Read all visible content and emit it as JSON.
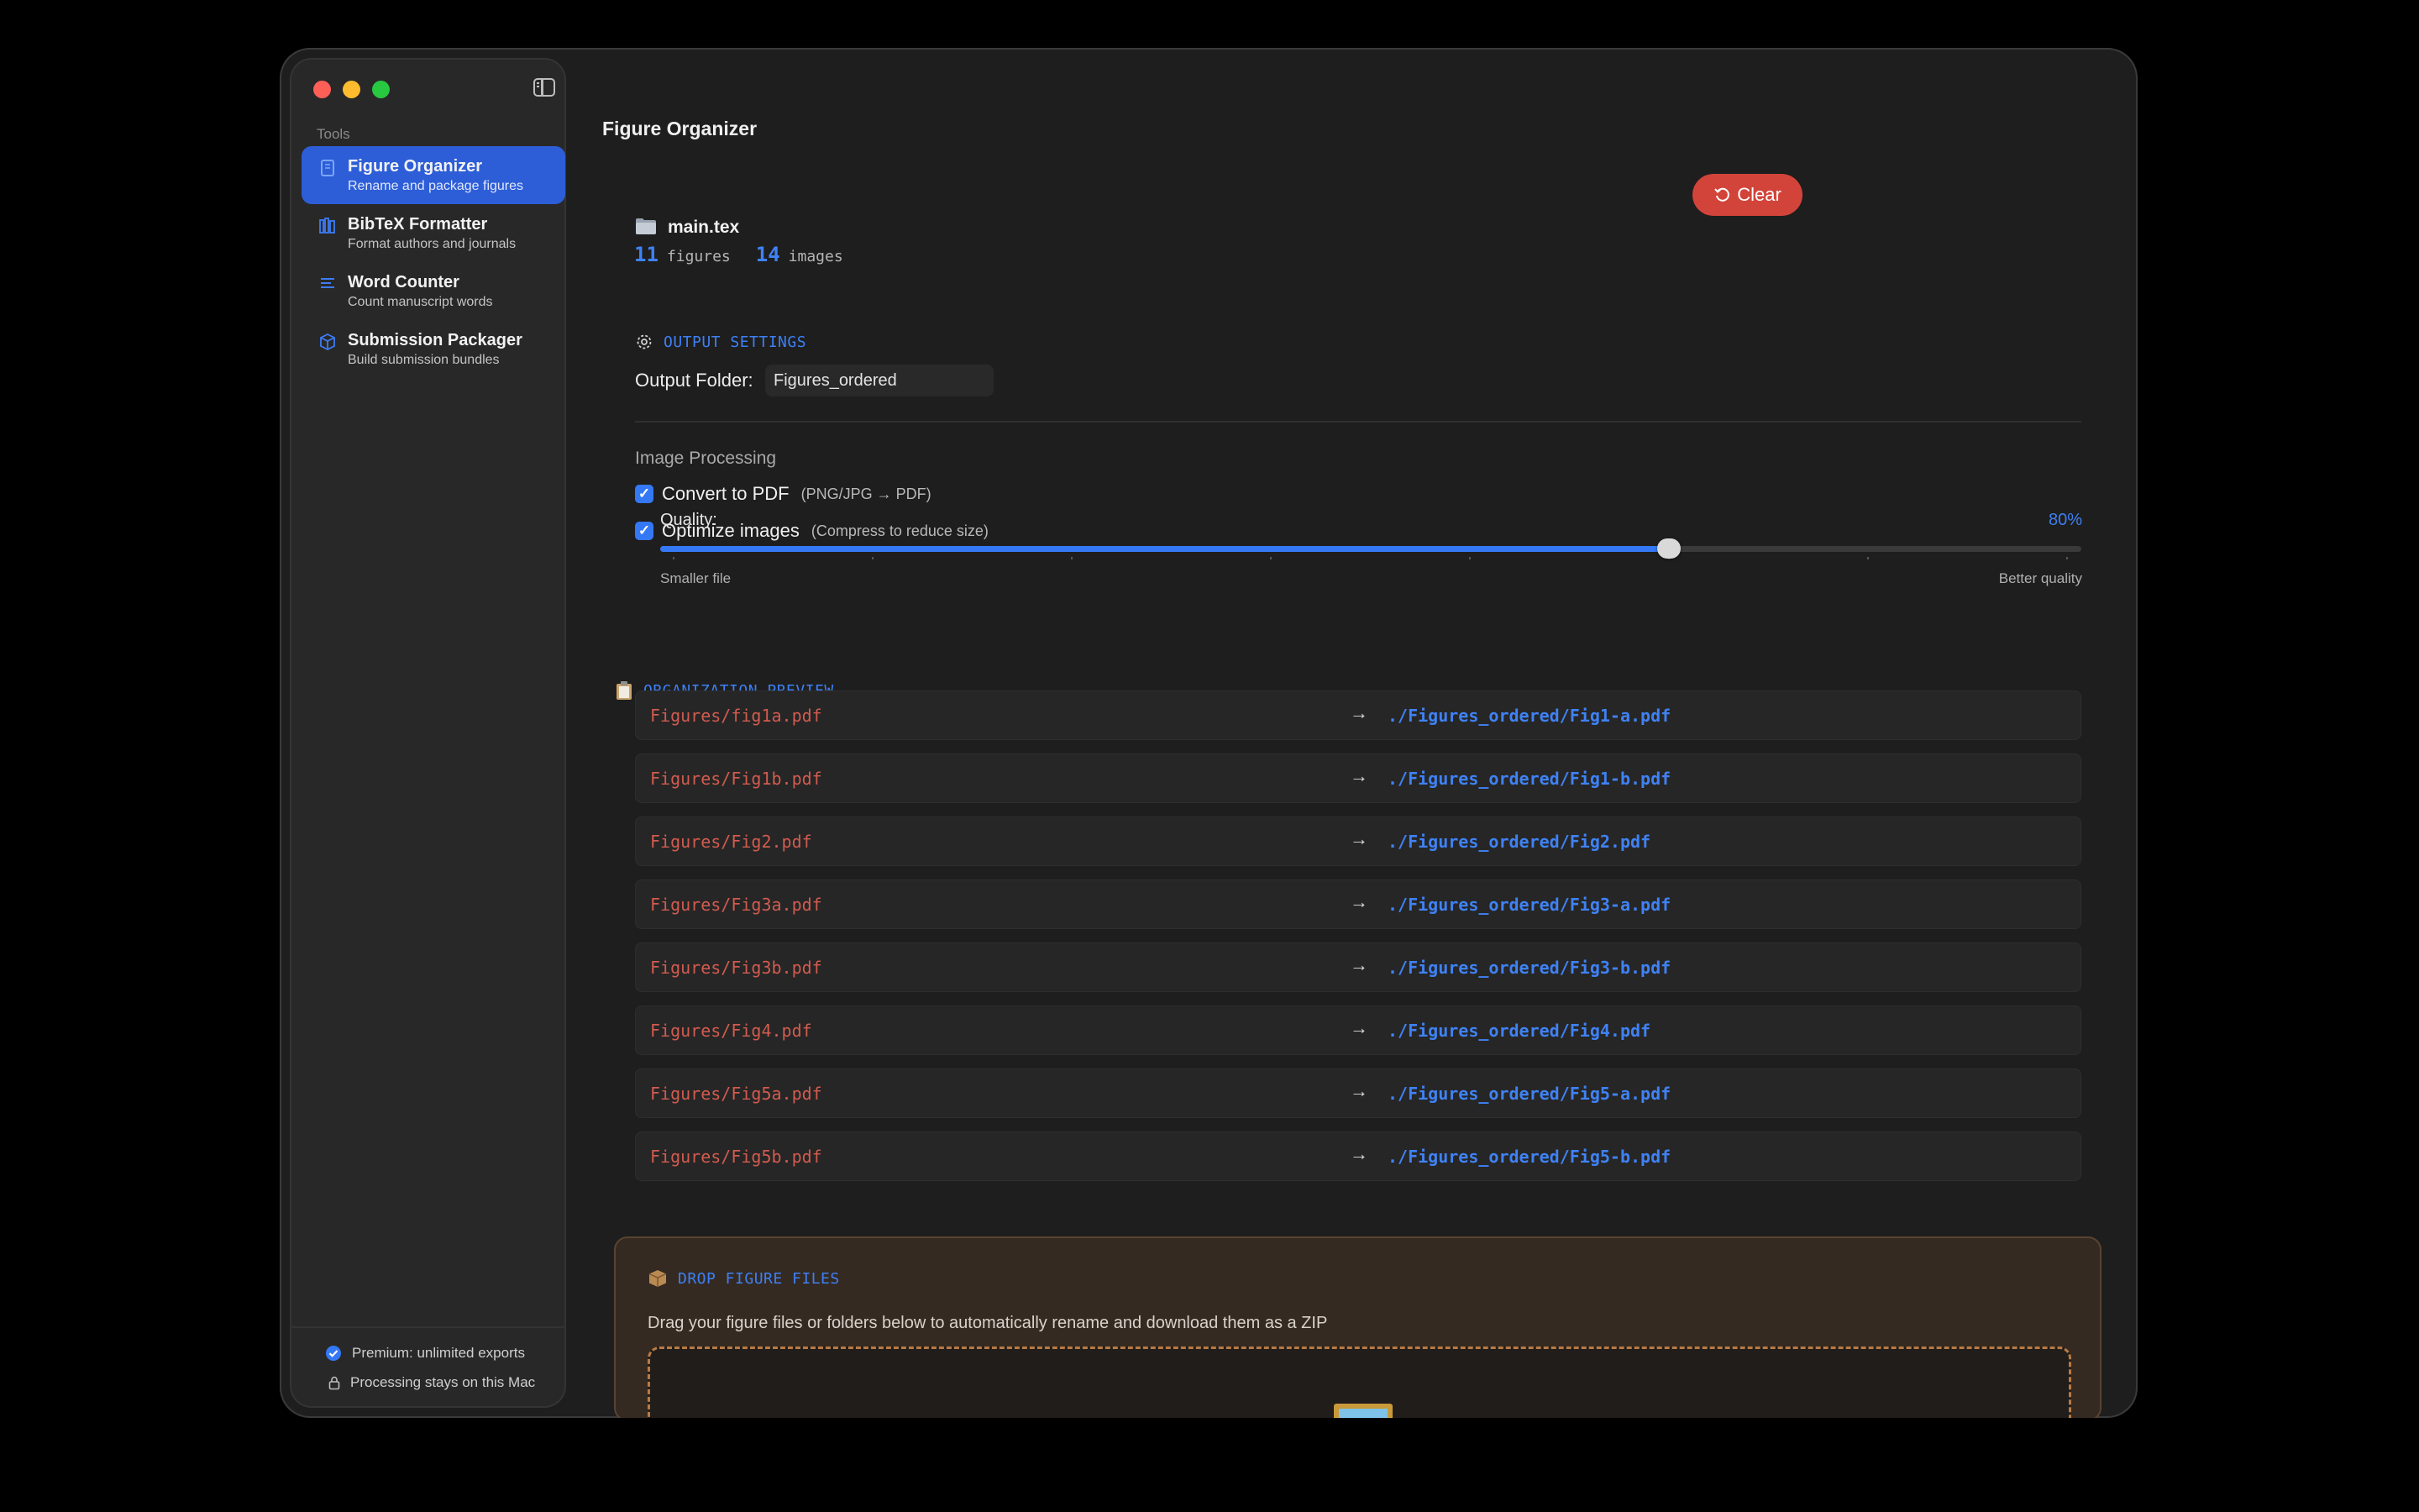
{
  "sidebar": {
    "section_label": "Tools",
    "items": [
      {
        "title": "Figure Organizer",
        "subtitle": "Rename and package figures",
        "icon": "document-icon",
        "active": true
      },
      {
        "title": "BibTeX Formatter",
        "subtitle": "Format authors and journals",
        "icon": "books-icon",
        "active": false
      },
      {
        "title": "Word Counter",
        "subtitle": "Count manuscript words",
        "icon": "text-lines-icon",
        "active": false
      },
      {
        "title": "Submission Packager",
        "subtitle": "Build submission bundles",
        "icon": "package-icon",
        "active": false
      }
    ],
    "footer": {
      "premium": "Premium: unlimited exports",
      "privacy": "Processing stays on this Mac"
    }
  },
  "header": {
    "title": "Figure Organizer"
  },
  "file": {
    "name": "main.tex",
    "figures_count": "11",
    "figures_label": "figures",
    "images_count": "14",
    "images_label": "images",
    "clear_label": "Clear"
  },
  "output_settings": {
    "heading": "OUTPUT SETTINGS",
    "folder_label": "Output Folder:",
    "folder_value": "Figures_ordered"
  },
  "image_processing": {
    "heading": "Image Processing",
    "convert_label": "Convert to PDF",
    "convert_hint": "(PNG/JPG → PDF)",
    "convert_checked": true,
    "optimize_label": "Optimize images",
    "optimize_hint": "(Compress to reduce size)",
    "optimize_checked": true,
    "quality_label": "Quality:",
    "quality_value": "80%",
    "quality_fraction": 0.71,
    "slider_min_label": "Smaller file",
    "slider_max_label": "Better quality"
  },
  "preview": {
    "heading": "ORGANIZATION PREVIEW",
    "rows": [
      {
        "src": "Figures/fig1a.pdf",
        "dst": "./Figures_ordered/Fig1-a.pdf"
      },
      {
        "src": "Figures/Fig1b.pdf",
        "dst": "./Figures_ordered/Fig1-b.pdf"
      },
      {
        "src": "Figures/Fig2.pdf",
        "dst": "./Figures_ordered/Fig2.pdf"
      },
      {
        "src": "Figures/Fig3a.pdf",
        "dst": "./Figures_ordered/Fig3-a.pdf"
      },
      {
        "src": "Figures/Fig3b.pdf",
        "dst": "./Figures_ordered/Fig3-b.pdf"
      },
      {
        "src": "Figures/Fig4.pdf",
        "dst": "./Figures_ordered/Fig4.pdf"
      },
      {
        "src": "Figures/Fig5a.pdf",
        "dst": "./Figures_ordered/Fig5-a.pdf"
      },
      {
        "src": "Figures/Fig5b.pdf",
        "dst": "./Figures_ordered/Fig5-b.pdf"
      }
    ],
    "arrow": "→"
  },
  "drop": {
    "heading": "DROP FIGURE FILES",
    "description": "Drag your figure files or folders below to automatically rename and download them as a ZIP"
  },
  "colors": {
    "accent": "#3478f6",
    "danger": "#d2443a",
    "source_path": "#d25b4f"
  }
}
